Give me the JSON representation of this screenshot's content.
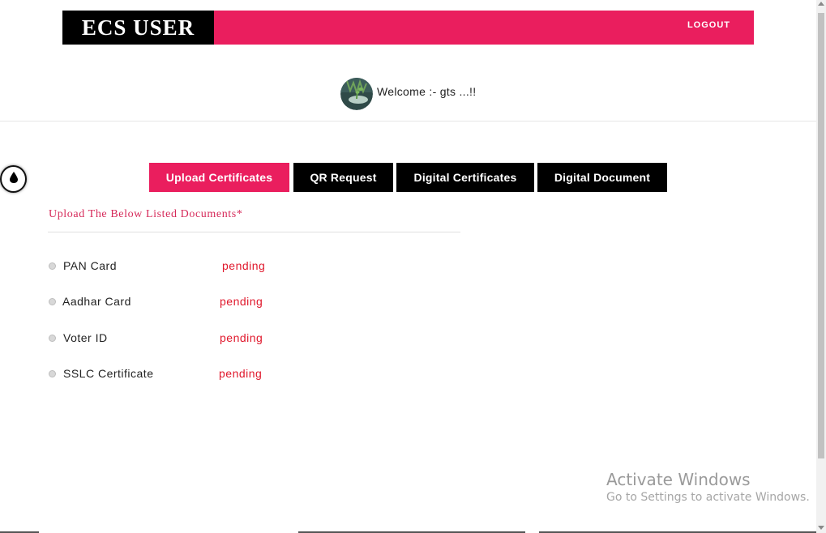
{
  "header": {
    "brand": "ECS USER",
    "logout_label": "LOGOUT",
    "accent_color": "#ea1e5e"
  },
  "welcome": {
    "text": "Welcome :- gts ...!!",
    "avatar_icon": "avatar-plant-in-hand"
  },
  "theme_toggle": {
    "icon": "droplet-icon"
  },
  "tabs": [
    {
      "label": "Upload Certificates",
      "active": true
    },
    {
      "label": "QR Request",
      "active": false
    },
    {
      "label": "Digital Certificates",
      "active": false
    },
    {
      "label": "Digital Document",
      "active": false
    }
  ],
  "section": {
    "title": "Upload The Below Listed Documents*"
  },
  "documents": [
    {
      "name": "PAN Card",
      "status": "pending"
    },
    {
      "name": "Aadhar Card",
      "status": "pending"
    },
    {
      "name": "Voter ID",
      "status": "pending"
    },
    {
      "name": "SSLC Certificate",
      "status": "pending"
    }
  ],
  "watermark": {
    "title": "Activate Windows",
    "subtitle": "Go to Settings to activate Windows."
  }
}
